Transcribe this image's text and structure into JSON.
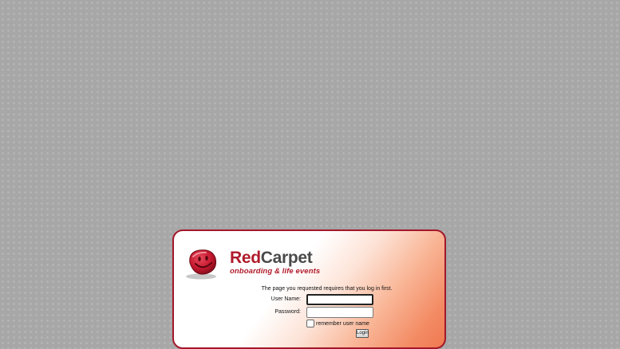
{
  "brand": {
    "name_part1": "Red",
    "name_part2": "Carpet",
    "tagline": "onboarding & life events"
  },
  "login": {
    "notice": "The page you requested requires that you log in first.",
    "username_label": "User Name:",
    "username_value": "",
    "password_label": "Password:",
    "password_value": "",
    "remember_label": "remember user name",
    "remember_checked": false,
    "submit_label": "Login"
  },
  "colors": {
    "brand_red": "#b01b2c",
    "panel_border": "#a3172a",
    "background_gray": "#a7a7a7"
  }
}
